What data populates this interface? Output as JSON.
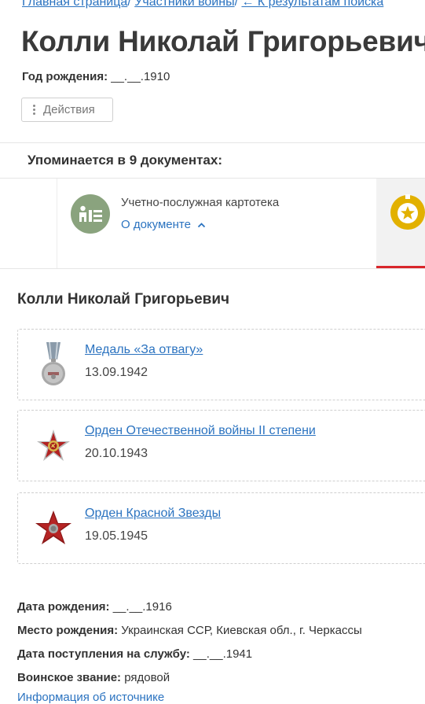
{
  "breadcrumb": {
    "home": "Главная страница",
    "participants": "Участники войны",
    "back": "← К результатам поиска"
  },
  "person": {
    "title": "Колли Николай Григорьевич",
    "birth_year_label": "Год рождения:",
    "birth_year_value": "__.__.1910"
  },
  "actions": {
    "label": "Действия",
    "icon": "vertical-dots-icon"
  },
  "documents": {
    "mentioned_label": "Упоминается в 9 документах:",
    "cards": [
      {
        "type": "Учетно-послужная картотека",
        "link": "О документе",
        "icon": "card-index-icon",
        "icon_color": "#8aa37e"
      },
      {
        "icon": "award-star-icon",
        "icon_color": "#e2b100"
      }
    ]
  },
  "record": {
    "name": "Колли Николай Григорьевич",
    "awards": [
      {
        "name": "Медаль «За отвагу»",
        "date": "13.09.1942",
        "icon": "medal-for-courage-icon"
      },
      {
        "name": "Орден Отечественной войны II степени",
        "date": "20.10.1943",
        "icon": "order-patriotic-war-icon"
      },
      {
        "name": "Орден Красной Звезды",
        "date": "19.05.1945",
        "icon": "order-red-star-icon"
      }
    ],
    "details": [
      {
        "label": "Дата рождения:",
        "value": "__.__.1916"
      },
      {
        "label": "Место рождения:",
        "value": "Украинская ССР, Киевская обл., г. Черкассы"
      },
      {
        "label": "Дата поступления на службу:",
        "value": "__.__.1941"
      },
      {
        "label": "Воинское звание:",
        "value": "рядовой"
      }
    ],
    "more_link": "Информация об источнике"
  },
  "colors": {
    "link": "#2b73c0",
    "accent_red": "#d9262b"
  }
}
